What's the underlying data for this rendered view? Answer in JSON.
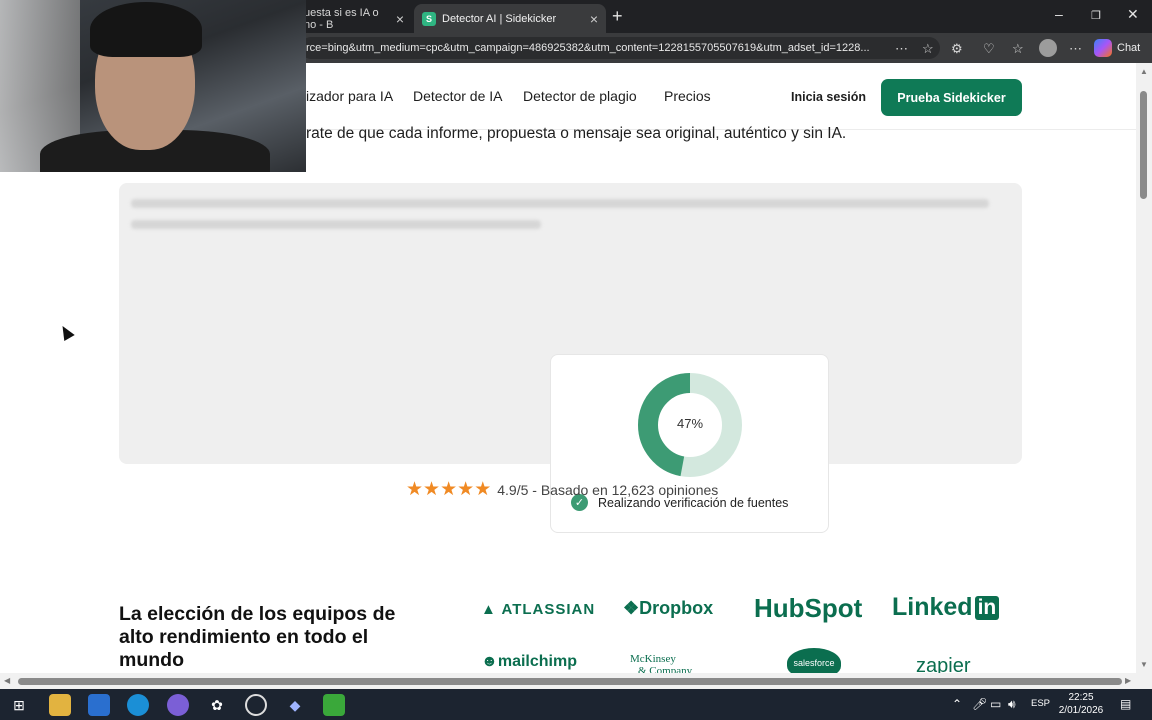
{
  "browser": {
    "tabs": [
      {
        "label": "uesta si es IA o no - B",
        "active": false
      },
      {
        "label": "Detector AI | Sidekicker",
        "active": true
      }
    ],
    "url": "rce=bing&utm_medium=cpc&utm_campaign=486925382&utm_content=1228155705507619&utm_adset_id=1228...",
    "chat_label": "Chat"
  },
  "nav": {
    "links": [
      "izador para IA",
      "Detector de IA",
      "Detector de plagio",
      "Precios"
    ],
    "login": "Inicia sesión",
    "cta": "Prueba Sidekicker"
  },
  "hero": {
    "subtitle": "rate de que cada informe, propuesta o mensaje sea original, auténtico y sin IA."
  },
  "analysis": {
    "progress_percent": 47,
    "progress_label": "47%",
    "status": "Realizando verificación de fuentes"
  },
  "rating": {
    "stars": 5,
    "text": "4.9/5 - Basado en 12,623 opiniones"
  },
  "teams": {
    "title": "La elección de los equipos de alto rendimiento en todo el mundo",
    "logos": [
      "ATLASSIAN",
      "Dropbox",
      "HubSpot",
      "Linked",
      "in",
      "mailchimp",
      "McKinsey",
      "& Company",
      "salesforce",
      "zapier"
    ]
  },
  "taskbar": {
    "lang": "ESP",
    "time": "22:25",
    "date": "2/01/2026"
  },
  "colors": {
    "brand_green": "#0f7a56",
    "donut_fill": "#3d9b74",
    "donut_track": "#d3e8de",
    "star": "#f08a24"
  }
}
